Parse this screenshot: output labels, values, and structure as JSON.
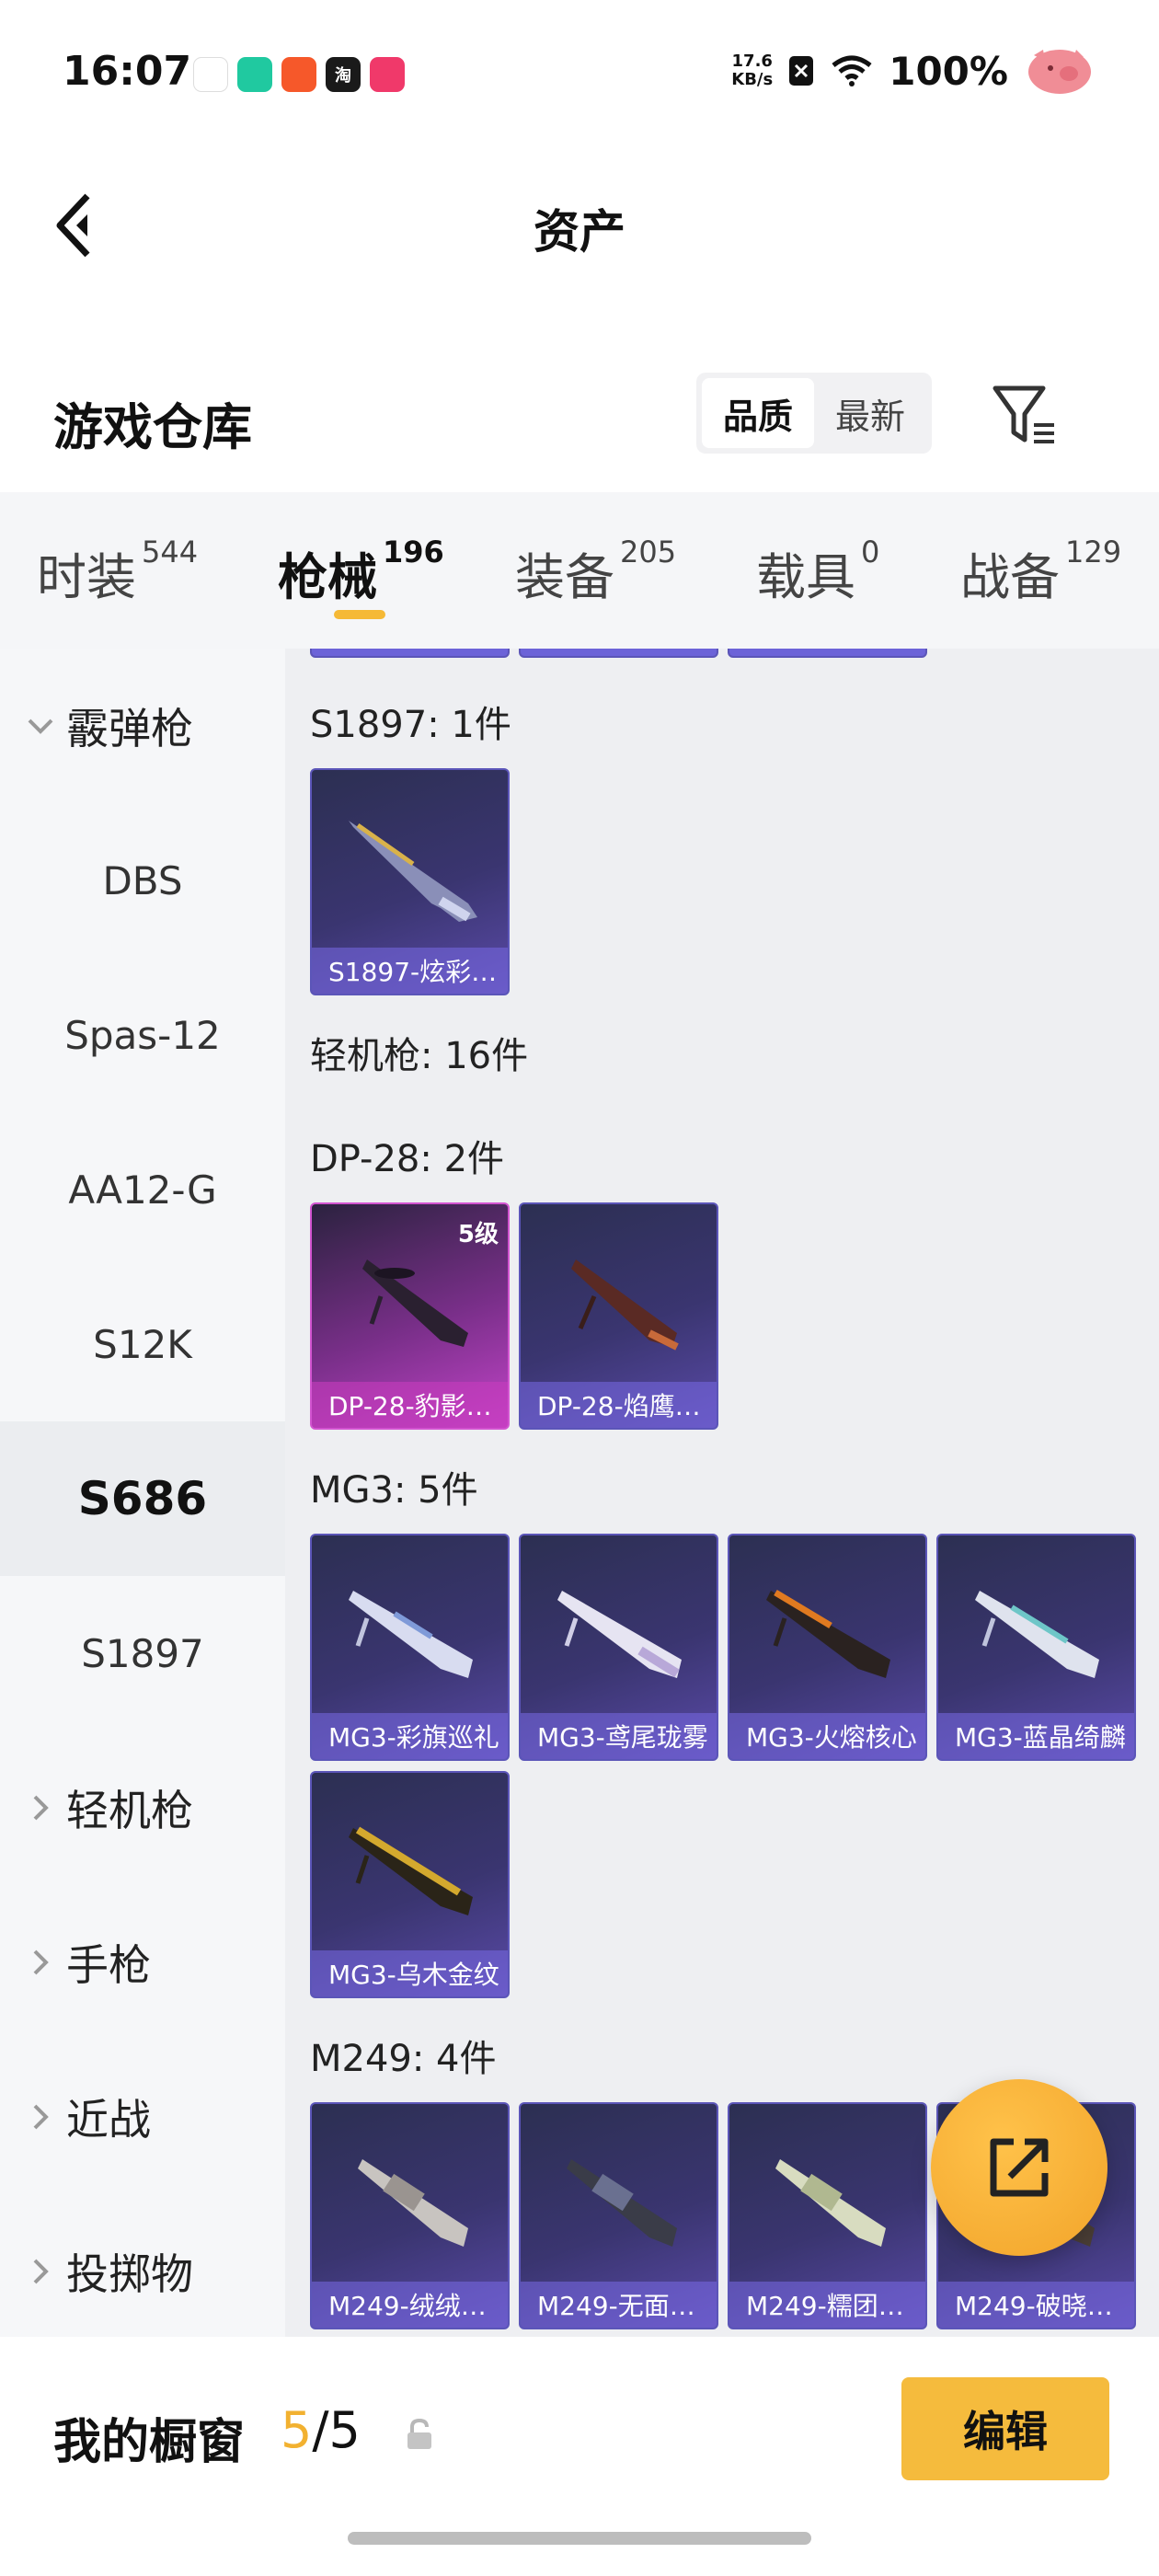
{
  "status_bar": {
    "time": "16:07",
    "net_speed_value": "17.6",
    "net_speed_unit": "KB/s",
    "battery": "100%",
    "app_icons": [
      {
        "name": "app-icon-1",
        "color": "#ffffff"
      },
      {
        "name": "app-icon-2",
        "color": "#20c9a0"
      },
      {
        "name": "app-icon-3",
        "color": "#f6582a"
      },
      {
        "name": "app-icon-taobao",
        "color": "#1a1a1a",
        "glyph": "淘"
      },
      {
        "name": "app-icon-5",
        "color": "#f0396a"
      }
    ]
  },
  "nav": {
    "title": "资产"
  },
  "warehouse": {
    "title": "游戏仓库",
    "sort_options": [
      "品质",
      "最新"
    ],
    "active_sort": "品质"
  },
  "tabs": [
    {
      "label": "时装",
      "count": "544"
    },
    {
      "label": "枪械",
      "count": "196",
      "active": true
    },
    {
      "label": "装备",
      "count": "205"
    },
    {
      "label": "载具",
      "count": "0"
    },
    {
      "label": "战备",
      "count": "129"
    }
  ],
  "sidebar": {
    "items": [
      {
        "label": "霰弹枪",
        "type": "group",
        "expanded": true
      },
      {
        "label": "DBS",
        "type": "sub"
      },
      {
        "label": "Spas-12",
        "type": "sub"
      },
      {
        "label": "AA12-G",
        "type": "sub"
      },
      {
        "label": "S12K",
        "type": "sub"
      },
      {
        "label": "S686",
        "type": "sub",
        "active": true
      },
      {
        "label": "S1897",
        "type": "sub"
      },
      {
        "label": "轻机枪",
        "type": "group"
      },
      {
        "label": "手枪",
        "type": "group"
      },
      {
        "label": "近战",
        "type": "group"
      },
      {
        "label": "投掷物",
        "type": "group"
      }
    ]
  },
  "content": {
    "sections": [
      {
        "label": "S1897: 1件",
        "cards": [
          {
            "name": "S1897-炫彩…"
          }
        ]
      },
      {
        "label": "轻机枪: 16件",
        "cards": []
      },
      {
        "label": "DP-28: 2件",
        "cards": [
          {
            "name": "DP-28-豹影…",
            "level": "5级",
            "style": "pink"
          },
          {
            "name": "DP-28-焰鹰…"
          }
        ]
      },
      {
        "label": "MG3: 5件",
        "cards": [
          {
            "name": "MG3-彩旗巡礼"
          },
          {
            "name": "MG3-鸢尾珑雾"
          },
          {
            "name": "MG3-火熔核心"
          },
          {
            "name": "MG3-蓝晶绮麟"
          },
          {
            "name": "MG3-乌木金纹"
          }
        ]
      },
      {
        "label": "M249: 4件",
        "cards": [
          {
            "name": "M249-绒绒…"
          },
          {
            "name": "M249-无面…"
          },
          {
            "name": "M249-糯团…"
          },
          {
            "name": "M249-破晓…"
          }
        ]
      }
    ]
  },
  "bottom": {
    "showcase_label": "我的橱窗",
    "showcase_current": "5",
    "showcase_sep_total": "/5",
    "edit_label": "编辑"
  },
  "colors": {
    "accent": "#f5bb3d",
    "card_purple": "#5b55b8",
    "card_pink": "#d254d0"
  }
}
